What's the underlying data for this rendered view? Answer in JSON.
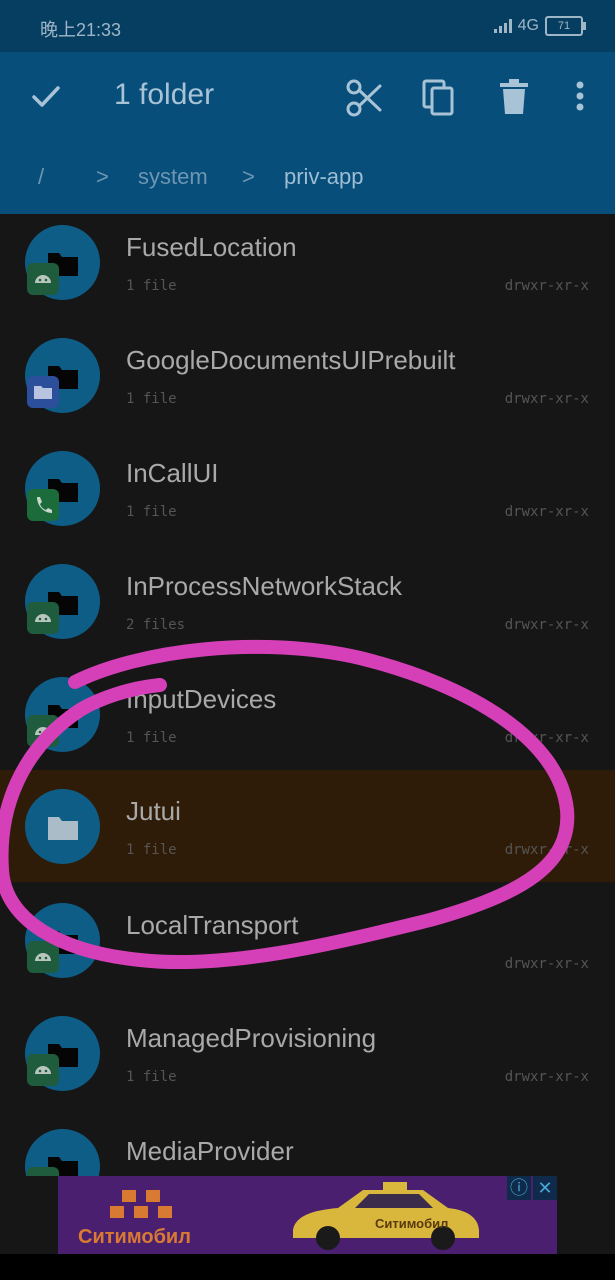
{
  "status_bar": {
    "time": "晚上21:33",
    "network": "4G",
    "battery": "71"
  },
  "toolbar": {
    "title": "1 folder"
  },
  "breadcrumb": {
    "root": "/",
    "sep1": ">",
    "part1": "system",
    "sep2": ">",
    "part2": "priv-app"
  },
  "files": [
    {
      "name": "FusedLocation",
      "count": "1 file",
      "perm": "drwxr-xr-x",
      "badge": "android-icon"
    },
    {
      "name": "GoogleDocumentsUIPrebuilt",
      "count": "1 file",
      "perm": "drwxr-xr-x",
      "badge": "docs-folder-icon"
    },
    {
      "name": "InCallUI",
      "count": "1 file",
      "perm": "drwxr-xr-x",
      "badge": "phone-icon"
    },
    {
      "name": "InProcessNetworkStack",
      "count": "2 files",
      "perm": "drwxr-xr-x",
      "badge": "android-icon"
    },
    {
      "name": "InputDevices",
      "count": "1 file",
      "perm": "drwxr-xr-x",
      "badge": "android-icon"
    },
    {
      "name": "Jutui",
      "count": "1 file",
      "perm": "drwxr-xr-x",
      "badge": "",
      "selected": true
    },
    {
      "name": "LocalTransport",
      "count": "",
      "perm": "drwxr-xr-x",
      "badge": "android-icon"
    },
    {
      "name": "ManagedProvisioning",
      "count": "1 file",
      "perm": "drwxr-xr-x",
      "badge": "android-icon"
    },
    {
      "name": "MediaProvider",
      "count": "",
      "perm": "",
      "badge": "android-icon"
    }
  ],
  "ad": {
    "brand": "Ситимобил",
    "car_label": "Ситимобил",
    "info": "ⓘ",
    "close": "✕"
  },
  "colors": {
    "toolbar": "#074e7b",
    "statusbar": "#063e62",
    "selected_row": "#2e1c08",
    "annotation": "#d53fb8"
  }
}
